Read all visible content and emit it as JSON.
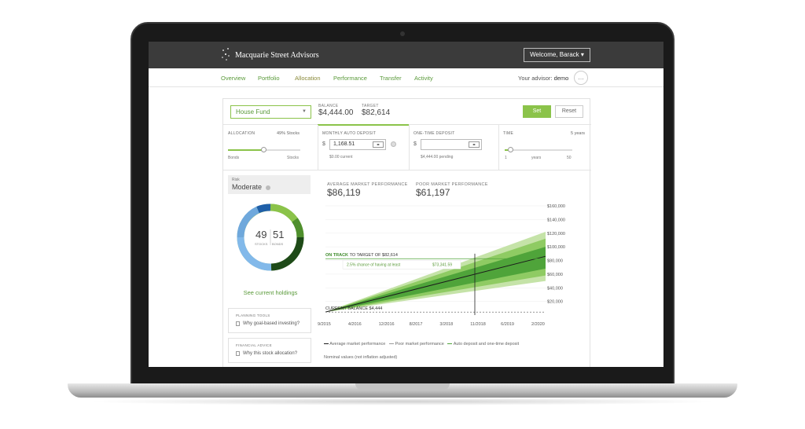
{
  "header": {
    "brand": "Macquarie Street Advisors",
    "welcome": "Welcome, Barack ▾"
  },
  "nav": {
    "tabs": [
      {
        "label": "Overview"
      },
      {
        "label": "Portfolio"
      },
      {
        "label": "Allocation"
      },
      {
        "label": "Performance"
      },
      {
        "label": "Transfer"
      },
      {
        "label": "Activity"
      }
    ],
    "active_tab": "Allocation",
    "advisor_prefix": "Your advisor:",
    "advisor_name": "demo"
  },
  "goal": {
    "selected": "House Fund",
    "balance_label": "BALANCE",
    "balance": "$4,444.00",
    "target_label": "TARGET",
    "target": "$82,614",
    "set_label": "Set",
    "reset_label": "Reset"
  },
  "allocation": {
    "label": "ALLOCATION",
    "stocks_pct_label": "49% Stocks",
    "left": "Bonds",
    "right": "Stocks",
    "value_pct": 49
  },
  "monthly_deposit": {
    "label": "MONTHLY AUTO DEPOSIT",
    "currency": "$",
    "value": "1,168.51",
    "sub": "$0.00 current"
  },
  "one_time_deposit": {
    "label": "ONE-TIME DEPOSIT",
    "currency": "$",
    "value": "",
    "sub": "$4,444.00 pending"
  },
  "time": {
    "label": "TIME",
    "value_label": "5 years",
    "min": "1",
    "unit": "years",
    "max": "50",
    "value": 5
  },
  "risk": {
    "label": "Risk",
    "value": "Moderate"
  },
  "donut": {
    "stocks": "49",
    "bonds": "51",
    "stocks_caption": "STOCKS",
    "bonds_caption": "BONDS",
    "colors": {
      "stocks": "#6fa8dc",
      "bonds": "#2e6b1f",
      "bonds_light": "#8bc34a",
      "stocks_dark": "#1f5fa8"
    }
  },
  "links": {
    "holdings": "See current holdings"
  },
  "tools": [
    {
      "title": "PLANNING TOOLS",
      "item": "Why goal-based investing?"
    },
    {
      "title": "FINANCIAL ADVICE",
      "item": "Why this stock allocation?"
    }
  ],
  "performance": {
    "avg_label": "AVERAGE MARKET PERFORMANCE",
    "avg_value": "$86,119",
    "poor_label": "POOR MARKET PERFORMANCE",
    "poor_value": "$61,197",
    "on_track_prefix": "ON TRACK",
    "on_track_text": "TO TARGET OF $82,614",
    "tooltip_text": "2.5% chance of having at least",
    "tooltip_value": "$73,341.59",
    "current_balance": "CURRENT BALANCE $4,444",
    "legend_avg": "Average market performance",
    "legend_poor": "Poor market performance",
    "legend_deposit": "Auto deposit and one-time deposit",
    "nominal": "Nominal values (not inflation adjusted)"
  },
  "chart_data": {
    "type": "area",
    "x_ticks": [
      "9/2015",
      "4/2016",
      "12/2016",
      "8/2017",
      "3/2018",
      "11/2018",
      "6/2019",
      "2/2020"
    ],
    "y_ticks": [
      "$160,000",
      "$140,000",
      "$120,000",
      "$100,000",
      "$80,000",
      "$60,000",
      "$40,000",
      "$20,000"
    ],
    "ylim": [
      0,
      160000
    ],
    "target": 82614,
    "start_balance": 4444,
    "series": [
      {
        "name": "Average market performance",
        "values": [
          4444,
          86119
        ]
      },
      {
        "name": "Poor market performance",
        "values": [
          4444,
          61197
        ]
      },
      {
        "name": "Auto deposit and one-time deposit",
        "values": [
          4444,
          75000
        ]
      }
    ],
    "colors": {
      "band_outer": "#c5e3a8",
      "band_mid": "#8fcb63",
      "band_inner": "#4fa43a",
      "avg_line": "#1b1b1b",
      "target_line": "#4fa43a"
    }
  }
}
